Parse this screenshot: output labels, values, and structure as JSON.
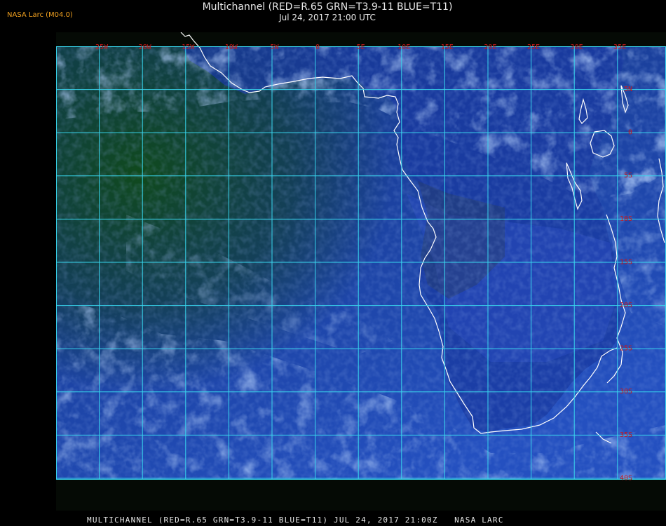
{
  "credit": "NASA Larc (M04.0)",
  "title": "Multichannel (RED=R.65 GRN=T3.9-11 BLUE=T11)",
  "subtitle": "Jul 24, 2017 21:00 UTC",
  "footer": "MULTICHANNEL (RED=R.65 GRN=T3.9-11 BLUE=T11) JUL 24, 2017 21:00Z   NASA LARC",
  "longitude_labels": [
    "25W",
    "20W",
    "15W",
    "10W",
    "5W",
    "0",
    "5E",
    "10E",
    "15E",
    "20E",
    "25E",
    "30E",
    "35E"
  ],
  "latitude_labels": [
    "5N",
    "0",
    "5S",
    "10S",
    "15S",
    "20S",
    "25S",
    "30S",
    "35S",
    "40S"
  ],
  "colors": {
    "grid": "#38d6ee",
    "coastline": "#ffffff",
    "grid_label": "#c81818",
    "credit": "#f0a020",
    "ocean": "#1c44b0",
    "land_dark": "#0e3a10",
    "cloud": "#6c9ce8"
  }
}
